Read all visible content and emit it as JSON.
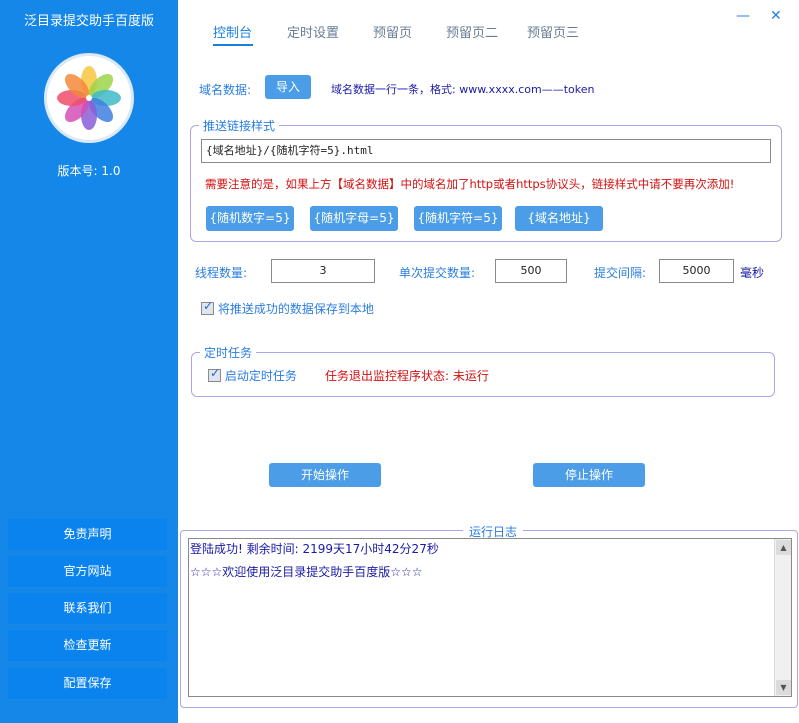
{
  "app": {
    "title": "泛目录提交助手百度版",
    "version_label": "版本号: 1.0"
  },
  "sidebar": {
    "items": [
      {
        "label": "免责声明"
      },
      {
        "label": "官方网站"
      },
      {
        "label": "联系我们"
      },
      {
        "label": "检查更新"
      },
      {
        "label": "配置保存"
      }
    ]
  },
  "tabs": [
    {
      "label": "控制台",
      "active": true
    },
    {
      "label": "定时设置"
    },
    {
      "label": "预留页"
    },
    {
      "label": "预留页二"
    },
    {
      "label": "预留页三"
    }
  ],
  "window": {
    "minimize": "—",
    "close": "✕"
  },
  "domain": {
    "label": "域名数据:",
    "import_button": "导入",
    "hint": "域名数据一行一条，格式: www.xxxx.com——token"
  },
  "link_style": {
    "title": "推送链接样式",
    "value": "{域名地址}/{随机字符=5}.html",
    "warning": "需要注意的是，如果上方【域名数据】中的域名加了http或者https协议头，链接样式中请不要再次添加!",
    "buttons": [
      "{随机数字=5}",
      "{随机字母=5}",
      "{随机字符=5}",
      "{域名地址}"
    ]
  },
  "settings": {
    "threads_label": "线程数量:",
    "threads_value": "3",
    "batch_label": "单次提交数量:",
    "batch_value": "500",
    "interval_label": "提交间隔:",
    "interval_value": "5000",
    "interval_unit": "毫秒",
    "save_checkbox_label": "将推送成功的数据保存到本地",
    "save_checked": true
  },
  "schedule": {
    "title": "定时任务",
    "enable_label": "启动定时任务",
    "enabled": true,
    "status": "任务退出监控程序状态: 未运行"
  },
  "actions": {
    "start": "开始操作",
    "stop": "停止操作"
  },
  "log": {
    "title": "运行日志",
    "lines": [
      "登陆成功! 剩余时间: 2199天17小时42分27秒",
      "☆☆☆欢迎使用泛目录提交助手百度版☆☆☆"
    ]
  }
}
